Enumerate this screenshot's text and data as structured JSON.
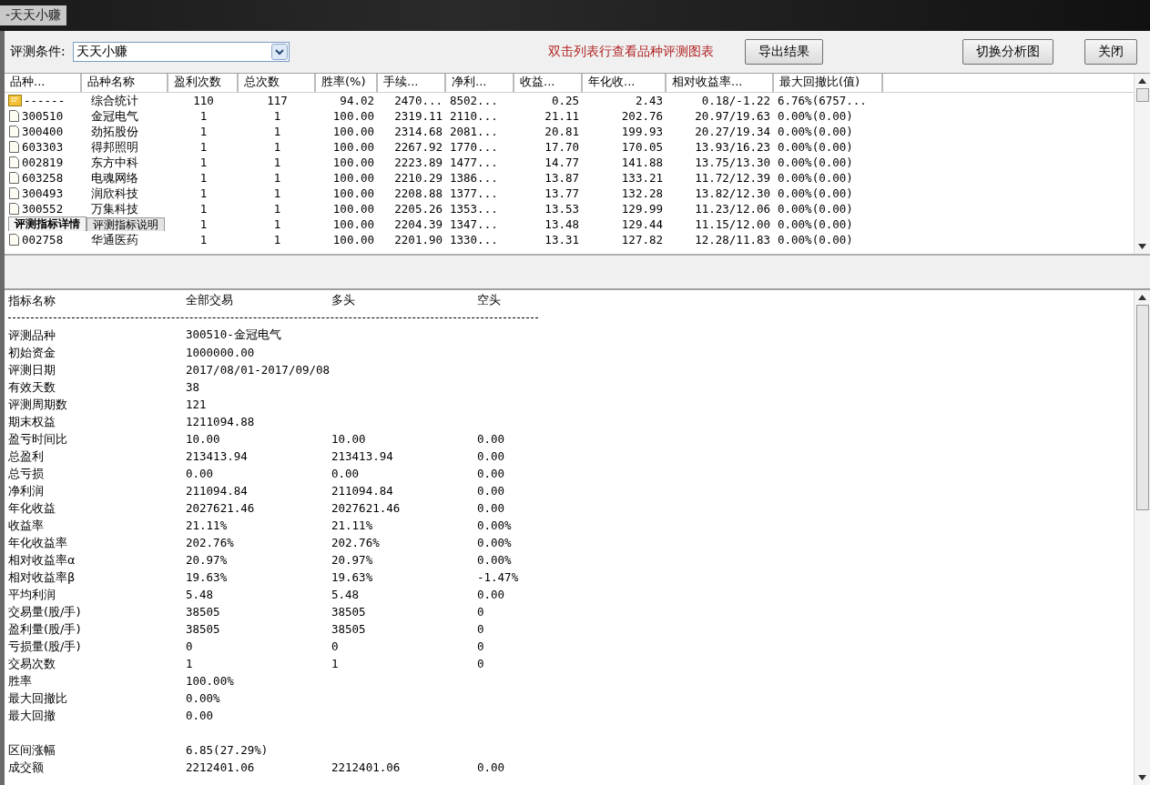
{
  "window": {
    "title": "-天天小赚"
  },
  "toolbar": {
    "label": "评测条件:",
    "condition": "天天小赚",
    "hint": "双击列表行查看品种评测图表",
    "buttons": [
      "导出结果",
      "切换分析图",
      "关闭"
    ]
  },
  "table": {
    "columns": [
      "品种...",
      "品种名称",
      "盈利次数",
      "总次数",
      "胜率(%)",
      "手续...",
      "净利...",
      "收益...",
      "年化收...",
      "相对收益率...",
      "最大回撤比(值)"
    ],
    "rows": [
      {
        "kind": "summary",
        "cells": [
          "------",
          "综合统计",
          "110",
          "117",
          "94.02",
          "2470...",
          "8502...",
          "0.25",
          "2.43",
          "0.18/-1.22",
          "6.76%(6757..."
        ]
      },
      {
        "kind": "stock",
        "cells": [
          "300510",
          "金冠电气",
          "1",
          "1",
          "100.00",
          "2319.11",
          "2110...",
          "21.11",
          "202.76",
          "20.97/19.63",
          "0.00%(0.00)"
        ]
      },
      {
        "kind": "stock",
        "cells": [
          "300400",
          "劲拓股份",
          "1",
          "1",
          "100.00",
          "2314.68",
          "2081...",
          "20.81",
          "199.93",
          "20.27/19.34",
          "0.00%(0.00)"
        ]
      },
      {
        "kind": "stock",
        "cells": [
          "603303",
          "得邦照明",
          "1",
          "1",
          "100.00",
          "2267.92",
          "1770...",
          "17.70",
          "170.05",
          "13.93/16.23",
          "0.00%(0.00)"
        ]
      },
      {
        "kind": "stock",
        "cells": [
          "002819",
          "东方中科",
          "1",
          "1",
          "100.00",
          "2223.89",
          "1477...",
          "14.77",
          "141.88",
          "13.75/13.30",
          "0.00%(0.00)"
        ]
      },
      {
        "kind": "stock",
        "cells": [
          "603258",
          "电魂网络",
          "1",
          "1",
          "100.00",
          "2210.29",
          "1386...",
          "13.87",
          "133.21",
          "11.72/12.39",
          "0.00%(0.00)"
        ]
      },
      {
        "kind": "stock",
        "cells": [
          "300493",
          "润欣科技",
          "1",
          "1",
          "100.00",
          "2208.88",
          "1377...",
          "13.77",
          "132.28",
          "13.82/12.30",
          "0.00%(0.00)"
        ]
      },
      {
        "kind": "stock",
        "cells": [
          "300552",
          "万集科技",
          "1",
          "1",
          "100.00",
          "2205.26",
          "1353...",
          "13.53",
          "129.99",
          "11.23/12.06",
          "0.00%(0.00)"
        ]
      },
      {
        "kind": "hidden",
        "cells": [
          "",
          "",
          "1",
          "1",
          "100.00",
          "2204.39",
          "1347...",
          "13.48",
          "129.44",
          "11.15/12.00",
          "0.00%(0.00)"
        ]
      },
      {
        "kind": "stock",
        "cells": [
          "002758",
          "华通医药",
          "1",
          "1",
          "100.00",
          "2201.90",
          "1330...",
          "13.31",
          "127.82",
          "12.28/11.83",
          "0.00%(0.00)"
        ]
      }
    ]
  },
  "tabs": [
    {
      "label": "评测指标详情",
      "selected": true
    },
    {
      "label": "评测指标说明",
      "selected": false
    }
  ],
  "detail": {
    "columns": [
      "指标名称",
      "全部交易",
      "多头",
      "空头"
    ],
    "rows": [
      {
        "kind": "rule"
      },
      {
        "kind": "row",
        "cells": [
          "评测品种",
          "300510-金冠电气"
        ]
      },
      {
        "kind": "row",
        "cells": [
          "初始资金",
          "1000000.00"
        ]
      },
      {
        "kind": "row",
        "cells": [
          "评测日期",
          "2017/08/01-2017/09/08"
        ]
      },
      {
        "kind": "row",
        "cells": [
          "有效天数",
          "38"
        ]
      },
      {
        "kind": "row",
        "cells": [
          "评测周期数",
          "121"
        ]
      },
      {
        "kind": "row",
        "cells": [
          "期末权益",
          "1211094.88"
        ]
      },
      {
        "kind": "row",
        "cells": [
          "盈亏时间比",
          "10.00",
          "10.00",
          "0.00"
        ]
      },
      {
        "kind": "row",
        "cells": [
          "总盈利",
          "213413.94",
          "213413.94",
          "0.00"
        ]
      },
      {
        "kind": "row",
        "cells": [
          "总亏损",
          "0.00",
          "0.00",
          "0.00"
        ]
      },
      {
        "kind": "row",
        "cells": [
          "净利润",
          "211094.84",
          "211094.84",
          "0.00"
        ]
      },
      {
        "kind": "row",
        "cells": [
          "年化收益",
          "2027621.46",
          "2027621.46",
          "0.00"
        ]
      },
      {
        "kind": "row",
        "cells": [
          "收益率",
          "21.11%",
          "21.11%",
          "0.00%"
        ]
      },
      {
        "kind": "row",
        "cells": [
          "年化收益率",
          "202.76%",
          "202.76%",
          "0.00%"
        ]
      },
      {
        "kind": "row",
        "cells": [
          "相对收益率α",
          "20.97%",
          "20.97%",
          "0.00%"
        ]
      },
      {
        "kind": "row",
        "cells": [
          "相对收益率β",
          "19.63%",
          "19.63%",
          "-1.47%"
        ]
      },
      {
        "kind": "row",
        "cells": [
          "平均利润",
          "5.48",
          "5.48",
          "0.00"
        ]
      },
      {
        "kind": "row",
        "cells": [
          "交易量(股/手)",
          "38505",
          "38505",
          "0"
        ]
      },
      {
        "kind": "row",
        "cells": [
          "盈利量(股/手)",
          "38505",
          "38505",
          "0"
        ]
      },
      {
        "kind": "row",
        "cells": [
          "亏损量(股/手)",
          "0",
          "0",
          "0"
        ]
      },
      {
        "kind": "row",
        "cells": [
          "交易次数",
          "1",
          "1",
          "0"
        ]
      },
      {
        "kind": "row",
        "cells": [
          "胜率",
          "100.00%"
        ]
      },
      {
        "kind": "row",
        "cells": [
          "最大回撤比",
          "0.00%"
        ]
      },
      {
        "kind": "row",
        "cells": [
          "最大回撤",
          "0.00"
        ]
      },
      {
        "kind": "gap"
      },
      {
        "kind": "row",
        "cells": [
          "区间涨幅",
          "6.85(27.29%)"
        ]
      },
      {
        "kind": "row",
        "cells": [
          "成交额",
          "2212401.06",
          "2212401.06",
          "0.00"
        ]
      }
    ]
  }
}
